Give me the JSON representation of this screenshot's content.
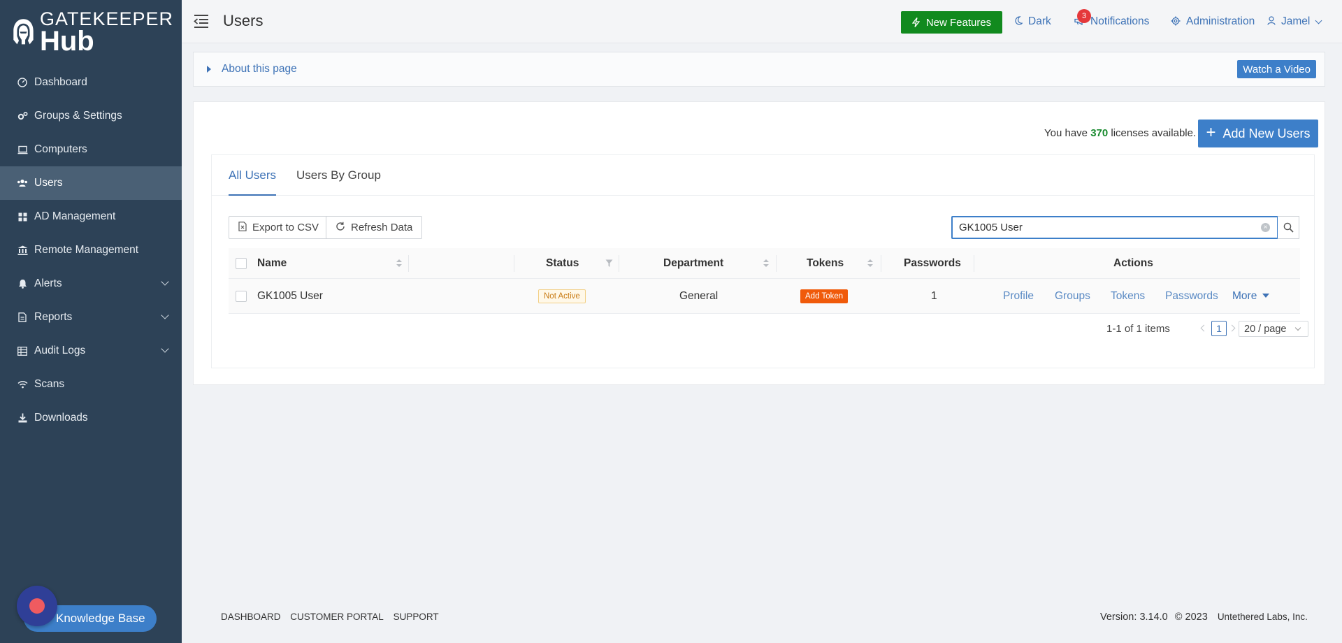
{
  "app": {
    "logo_line1": "GATEKEEPER",
    "logo_line2": "Hub"
  },
  "sidebar": {
    "items": [
      {
        "label": "Dashboard",
        "icon": "dashboard-icon",
        "active": false,
        "expandable": false
      },
      {
        "label": "Groups & Settings",
        "icon": "gears-icon",
        "active": false,
        "expandable": false
      },
      {
        "label": "Computers",
        "icon": "laptop-icon",
        "active": false,
        "expandable": false
      },
      {
        "label": "Users",
        "icon": "users-icon",
        "active": true,
        "expandable": false
      },
      {
        "label": "AD Management",
        "icon": "grid-icon",
        "active": false,
        "expandable": false
      },
      {
        "label": "Remote Management",
        "icon": "bank-icon",
        "active": false,
        "expandable": false
      },
      {
        "label": "Alerts",
        "icon": "bell-icon",
        "active": false,
        "expandable": true
      },
      {
        "label": "Reports",
        "icon": "document-icon",
        "active": false,
        "expandable": true
      },
      {
        "label": "Audit Logs",
        "icon": "table-icon",
        "active": false,
        "expandable": true
      },
      {
        "label": "Scans",
        "icon": "wifi-icon",
        "active": false,
        "expandable": false
      },
      {
        "label": "Downloads",
        "icon": "download-icon",
        "active": false,
        "expandable": false
      }
    ],
    "knowledge_base_label": "Knowledge Base"
  },
  "header": {
    "title": "Users",
    "new_features_label": "New Features",
    "dark_label": "Dark",
    "notifications_label": "Notifications",
    "notifications_count": "3",
    "administration_label": "Administration",
    "user_label": "Jamel"
  },
  "about": {
    "label": "About this page",
    "watch_video_label": "Watch a Video"
  },
  "licenses": {
    "prefix": "You have",
    "count": "370",
    "suffix": "licenses available."
  },
  "add_users_label": "Add New Users",
  "tabs": [
    {
      "label": "All Users",
      "active": true
    },
    {
      "label": "Users By Group",
      "active": false
    }
  ],
  "toolbar": {
    "export_label": "Export to CSV",
    "refresh_label": "Refresh Data"
  },
  "search": {
    "value": "GK1005 User",
    "placeholder": ""
  },
  "table": {
    "columns": [
      "Name",
      "Status",
      "Department",
      "Tokens",
      "Passwords",
      "Actions"
    ],
    "rows": [
      {
        "name": "GK1005 User",
        "status": "Not Active",
        "department": "General",
        "tokens_action": "Add Token",
        "passwords": "1",
        "actions": [
          "Profile",
          "Groups",
          "Tokens",
          "Passwords",
          "More"
        ]
      }
    ]
  },
  "pagination": {
    "summary": "1-1 of 1 items",
    "current_page": "1",
    "page_size": "20 / page"
  },
  "footer": {
    "links": [
      "DASHBOARD",
      "CUSTOMER PORTAL",
      "SUPPORT"
    ],
    "version_prefix": "Version:",
    "version": "3.14.0",
    "copyright": "© 2023",
    "company": "Untethered Labs, Inc."
  },
  "colors": {
    "sidebar_bg": "#2d4257",
    "accent": "#3d7fc9",
    "success": "#118a1e",
    "token_orange": "#f05a0a"
  }
}
